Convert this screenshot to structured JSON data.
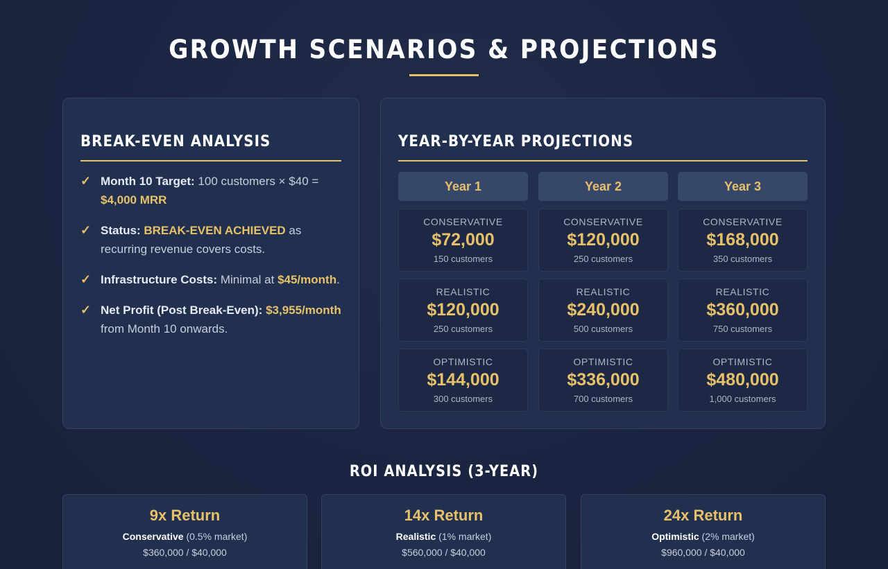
{
  "page": {
    "title": "GROWTH SCENARIOS & PROJECTIONS"
  },
  "breakeven": {
    "heading": "BREAK-EVEN ANALYSIS",
    "items": [
      {
        "label": "Month 10 Target:",
        "text": " 100 customers × $40 = ",
        "highlight": "$4,000 MRR",
        "suffix": ""
      },
      {
        "label": "Status:",
        "text": " ",
        "highlight": "BREAK-EVEN ACHIEVED",
        "suffix": " as recurring revenue covers costs."
      },
      {
        "label": "Infrastructure Costs:",
        "text": " Minimal at ",
        "highlight": "$45/month",
        "suffix": "."
      },
      {
        "label": "Net Profit (Post Break-Even):",
        "text": " ",
        "highlight": "$3,955/month",
        "suffix": " from Month 10 onwards."
      }
    ],
    "check_icon": "✓"
  },
  "projections": {
    "heading": "YEAR-BY-YEAR PROJECTIONS",
    "years": [
      "Year 1",
      "Year 2",
      "Year 3"
    ],
    "scenarios": [
      "CONSERVATIVE",
      "REALISTIC",
      "OPTIMISTIC"
    ],
    "values": [
      [
        {
          "value": "$72,000",
          "customers": "150 customers"
        },
        {
          "value": "$120,000",
          "customers": "250 customers"
        },
        {
          "value": "$168,000",
          "customers": "350 customers"
        }
      ],
      [
        {
          "value": "$120,000",
          "customers": "250 customers"
        },
        {
          "value": "$240,000",
          "customers": "500 customers"
        },
        {
          "value": "$360,000",
          "customers": "750 customers"
        }
      ],
      [
        {
          "value": "$144,000",
          "customers": "300 customers"
        },
        {
          "value": "$336,000",
          "customers": "700 customers"
        },
        {
          "value": "$480,000",
          "customers": "1,000 customers"
        }
      ]
    ]
  },
  "roi": {
    "title": "ROI ANALYSIS (3-YEAR)",
    "cards": [
      {
        "return": "9x Return",
        "scenario": "Conservative",
        "market": " (0.5% market)",
        "calc": "$360,000 / $40,000"
      },
      {
        "return": "14x Return",
        "scenario": "Realistic",
        "market": " (1% market)",
        "calc": "$560,000 / $40,000"
      },
      {
        "return": "24x Return",
        "scenario": "Optimistic",
        "market": " (2% market)",
        "calc": "$960,000 / $40,000"
      }
    ]
  },
  "colors": {
    "background": "#1b2540",
    "card": "#223050",
    "accent": "#e7c06a",
    "cell": "#1c2844",
    "year_header": "#364769"
  }
}
